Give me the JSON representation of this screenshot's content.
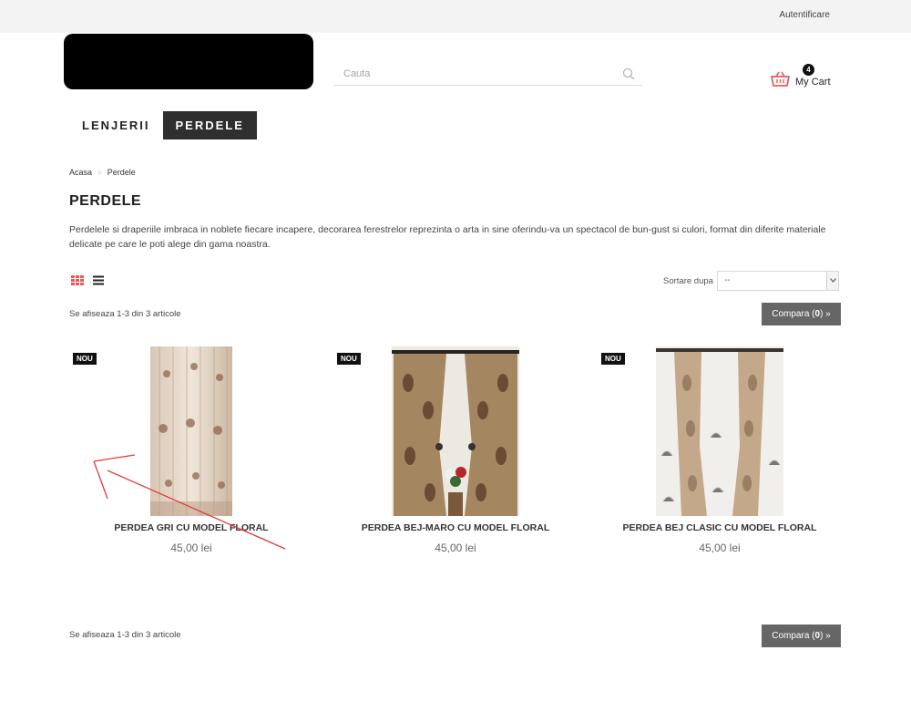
{
  "topbar": {
    "auth_link": "Autentificare"
  },
  "search": {
    "placeholder": "Cauta"
  },
  "cart": {
    "count": "4",
    "label": "My Cart"
  },
  "nav": {
    "items": [
      {
        "label": "LENJERII"
      },
      {
        "label": "PERDELE"
      }
    ]
  },
  "breadcrumb": {
    "home": "Acasa",
    "sep": ">",
    "current": "Perdele"
  },
  "page": {
    "title": "PERDELE",
    "description": "Perdelele si draperiile imbraca in noblete fiecare incapere, decorarea ferestrelor reprezinta o arta in sine oferindu-va un spectacol de bun-gust si culori, format din diferite materiale delicate pe care le poti alege din gama noastra."
  },
  "toolbar": {
    "sort_label": "Sortare dupa",
    "sort_value": "--"
  },
  "listing": {
    "results_text": "Se afiseaza 1-3 din 3 articole",
    "compare_label": "Compara (",
    "compare_count": "0",
    "compare_suffix": ") »"
  },
  "products": [
    {
      "badge": "NOU",
      "name": "PERDEA GRI CU MODEL FLORAL",
      "price": "45,00 lei"
    },
    {
      "badge": "NOU",
      "name": "PERDEA BEJ-MARO CU MODEL FLORAL",
      "price": "45,00 lei"
    },
    {
      "badge": "NOU",
      "name": "PERDEA BEJ CLASIC CU MODEL FLORAL",
      "price": "45,00 lei"
    }
  ],
  "colors": {
    "accent": "#e85a5a",
    "dark": "#2f2f2f",
    "compare_bg": "#666666"
  }
}
